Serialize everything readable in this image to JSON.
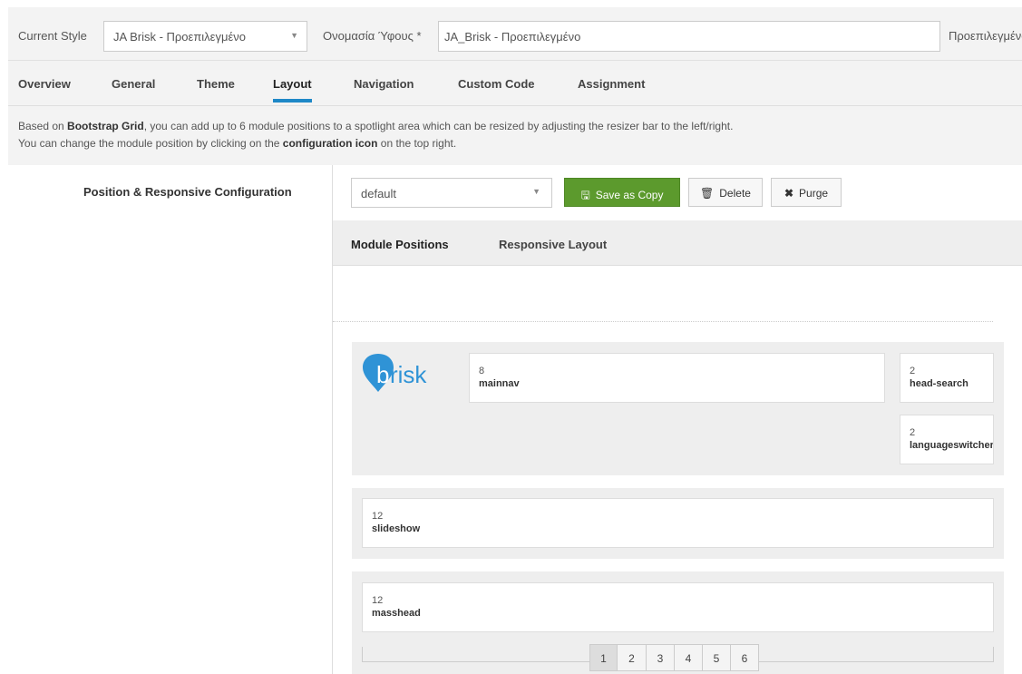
{
  "style_bar": {
    "current_style_label": "Current Style",
    "current_style_value": "JA Brisk - Προεπιλεγμένο",
    "style_name_label": "Ονομασία Ύφους *",
    "style_name_value": "JA_Brisk - Προεπιλεγμένο",
    "right_label": "Προεπιλεγμένο"
  },
  "tabs": [
    "Overview",
    "General",
    "Theme",
    "Layout",
    "Navigation",
    "Custom Code",
    "Assignment"
  ],
  "active_tab": "Layout",
  "info": {
    "t1": "Based on ",
    "b1": "Bootstrap Grid",
    "t2": ", you can add up to 6 module positions to a spotlight area which can be resized by adjusting the resizer bar to the left/right.",
    "t3": "You can change the module position by clicking on the ",
    "b2": "configuration icon",
    "t4": " on the top right."
  },
  "config": {
    "label": "Position & Responsive Configuration",
    "layout_select_value": "default",
    "save_copy": "Save as Copy",
    "delete": "Delete",
    "purge": "Purge"
  },
  "subtabs": [
    "Module Positions",
    "Responsive Layout"
  ],
  "logo_text": "brisk",
  "positions": {
    "mainnav": {
      "span": "8",
      "name": "mainnav"
    },
    "head_search": {
      "span": "2",
      "name": "head-search"
    },
    "languageswitcher": {
      "span": "2",
      "name": "languageswitcher"
    },
    "slideshow": {
      "span": "12",
      "name": "slideshow"
    },
    "masshead": {
      "span": "12",
      "name": "masshead"
    }
  },
  "pager": [
    "1",
    "2",
    "3",
    "4",
    "5",
    "6"
  ],
  "colors": {
    "accent": "#1e88c7",
    "save_button": "#5c9a2d",
    "logo_blue": "#2f93d6"
  }
}
